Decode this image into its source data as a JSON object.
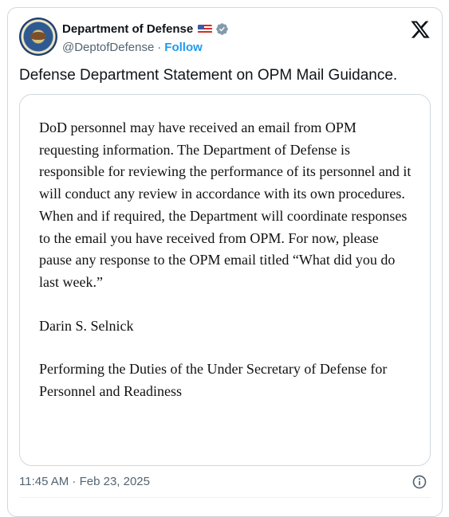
{
  "account": {
    "display_name": "Department of Defense",
    "flag_icon": "us-flag-icon",
    "handle": "@DeptofDefense",
    "separator": "·",
    "follow_label": "Follow",
    "verified_color": "#829aab"
  },
  "tweet": {
    "text": "Defense Department Statement on OPM Mail Guidance.",
    "timestamp": "11:45 AM · Feb 23, 2025"
  },
  "statement": {
    "paragraph_1": "DoD personnel may have received an email from OPM requesting information. The Department of Defense is responsible for reviewing the performance of its personnel and it will conduct any review in accordance with its own procedures. When and if required, the Department will coordinate responses to the email you have received from OPM. For now, please pause any response to the OPM email titled “What did you do last week.”",
    "signatory": "Darin S. Selnick",
    "title": "Performing the Duties of the Under Secretary of Defense for Personnel and Readiness"
  },
  "colors": {
    "link": "#1d9bf0",
    "muted": "#536471",
    "border": "#cfd9de"
  }
}
